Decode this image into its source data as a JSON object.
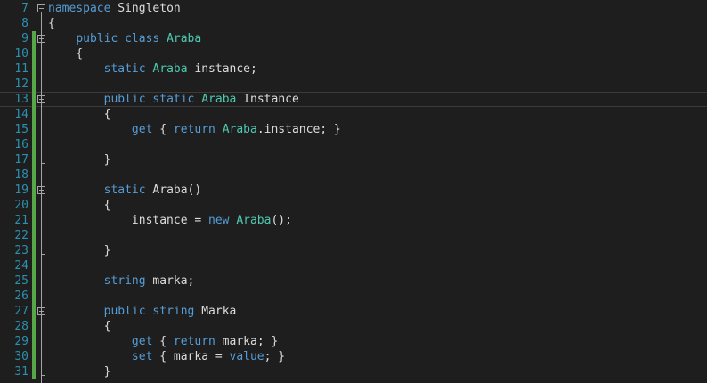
{
  "editor": {
    "lines": [
      {
        "no": "7",
        "tokens": [
          {
            "t": "namespace",
            "c": "kw"
          },
          {
            "t": " Singleton",
            "c": "tx"
          }
        ]
      },
      {
        "no": "8",
        "tokens": [
          {
            "t": "{",
            "c": "tx"
          }
        ]
      },
      {
        "no": "9",
        "tokens": [
          {
            "t": "    ",
            "c": "tx"
          },
          {
            "t": "public",
            "c": "kw"
          },
          {
            "t": " ",
            "c": "tx"
          },
          {
            "t": "class",
            "c": "kw"
          },
          {
            "t": " ",
            "c": "tx"
          },
          {
            "t": "Araba",
            "c": "ty"
          }
        ]
      },
      {
        "no": "10",
        "tokens": [
          {
            "t": "    {",
            "c": "tx"
          }
        ]
      },
      {
        "no": "11",
        "tokens": [
          {
            "t": "        ",
            "c": "tx"
          },
          {
            "t": "static",
            "c": "kw"
          },
          {
            "t": " ",
            "c": "tx"
          },
          {
            "t": "Araba",
            "c": "ty"
          },
          {
            "t": " instance;",
            "c": "tx"
          }
        ]
      },
      {
        "no": "12",
        "tokens": []
      },
      {
        "no": "13",
        "tokens": [
          {
            "t": "        ",
            "c": "tx"
          },
          {
            "t": "public",
            "c": "kw"
          },
          {
            "t": " ",
            "c": "tx"
          },
          {
            "t": "static",
            "c": "kw"
          },
          {
            "t": " ",
            "c": "tx"
          },
          {
            "t": "Araba",
            "c": "ty"
          },
          {
            "t": " Instance",
            "c": "tx"
          }
        ]
      },
      {
        "no": "14",
        "tokens": [
          {
            "t": "        {",
            "c": "tx"
          }
        ]
      },
      {
        "no": "15",
        "tokens": [
          {
            "t": "            ",
            "c": "tx"
          },
          {
            "t": "get",
            "c": "kw"
          },
          {
            "t": " { ",
            "c": "tx"
          },
          {
            "t": "return",
            "c": "kw"
          },
          {
            "t": " ",
            "c": "tx"
          },
          {
            "t": "Araba",
            "c": "ty"
          },
          {
            "t": ".instance; }",
            "c": "tx"
          }
        ]
      },
      {
        "no": "16",
        "tokens": []
      },
      {
        "no": "17",
        "tokens": [
          {
            "t": "        }",
            "c": "tx"
          }
        ]
      },
      {
        "no": "18",
        "tokens": []
      },
      {
        "no": "19",
        "tokens": [
          {
            "t": "        ",
            "c": "tx"
          },
          {
            "t": "static",
            "c": "kw"
          },
          {
            "t": " Araba()",
            "c": "tx"
          }
        ]
      },
      {
        "no": "20",
        "tokens": [
          {
            "t": "        {",
            "c": "tx"
          }
        ]
      },
      {
        "no": "21",
        "tokens": [
          {
            "t": "            instance = ",
            "c": "tx"
          },
          {
            "t": "new",
            "c": "kw"
          },
          {
            "t": " ",
            "c": "tx"
          },
          {
            "t": "Araba",
            "c": "ty"
          },
          {
            "t": "();",
            "c": "tx"
          }
        ]
      },
      {
        "no": "22",
        "tokens": []
      },
      {
        "no": "23",
        "tokens": [
          {
            "t": "        }",
            "c": "tx"
          }
        ]
      },
      {
        "no": "24",
        "tokens": []
      },
      {
        "no": "25",
        "tokens": [
          {
            "t": "        ",
            "c": "tx"
          },
          {
            "t": "string",
            "c": "kw"
          },
          {
            "t": " marka;",
            "c": "tx"
          }
        ]
      },
      {
        "no": "26",
        "tokens": []
      },
      {
        "no": "27",
        "tokens": [
          {
            "t": "        ",
            "c": "tx"
          },
          {
            "t": "public",
            "c": "kw"
          },
          {
            "t": " ",
            "c": "tx"
          },
          {
            "t": "string",
            "c": "kw"
          },
          {
            "t": " Marka",
            "c": "tx"
          }
        ]
      },
      {
        "no": "28",
        "tokens": [
          {
            "t": "        {",
            "c": "tx"
          }
        ]
      },
      {
        "no": "29",
        "tokens": [
          {
            "t": "            ",
            "c": "tx"
          },
          {
            "t": "get",
            "c": "kw"
          },
          {
            "t": " { ",
            "c": "tx"
          },
          {
            "t": "return",
            "c": "kw"
          },
          {
            "t": " marka; }",
            "c": "tx"
          }
        ]
      },
      {
        "no": "30",
        "tokens": [
          {
            "t": "            ",
            "c": "tx"
          },
          {
            "t": "set",
            "c": "kw"
          },
          {
            "t": " { marka = ",
            "c": "tx"
          },
          {
            "t": "value",
            "c": "kw"
          },
          {
            "t": "; }",
            "c": "tx"
          }
        ]
      },
      {
        "no": "31",
        "tokens": [
          {
            "t": "        }",
            "c": "tx"
          }
        ]
      }
    ],
    "current_line": "13",
    "modified_lines": [
      "9",
      "10",
      "11",
      "12",
      "13",
      "14",
      "15",
      "16",
      "17",
      "18",
      "19",
      "20",
      "21",
      "22",
      "23",
      "24",
      "25",
      "26",
      "27",
      "28",
      "29",
      "30",
      "31"
    ],
    "fold_starts": [
      "7",
      "9",
      "13",
      "19",
      "27"
    ],
    "fold_ends": [
      "17",
      "23",
      "31"
    ],
    "colors": {
      "background": "#1e1e1e",
      "line_number": "#2b91af",
      "keyword": "#569cd6",
      "type": "#4ec9b0",
      "text": "#dcdcdc",
      "change_bar": "#57a64a"
    }
  }
}
